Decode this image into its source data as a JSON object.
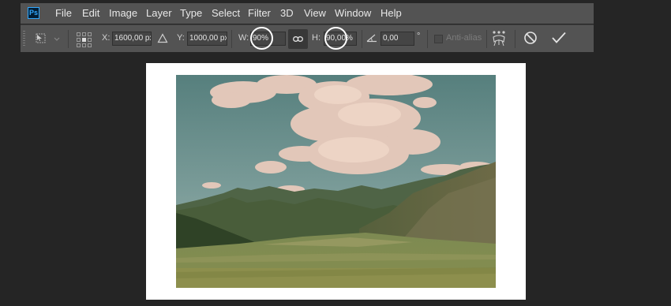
{
  "app": {
    "logo_text": "Ps"
  },
  "menu": {
    "items": [
      "File",
      "Edit",
      "Image",
      "Layer",
      "Type",
      "Select",
      "Filter",
      "3D",
      "View",
      "Window",
      "Help"
    ]
  },
  "options": {
    "x_label": "X:",
    "x_value": "1600,00 px",
    "y_label": "Y:",
    "y_value": "1000,00 px",
    "w_label": "W:",
    "w_value": "90%",
    "h_label": "H:",
    "h_value": "90,00%",
    "angle_value": "0,00",
    "degree_symbol": "°",
    "antialias_label": "Anti-alias"
  },
  "colors": {
    "chrome": "#535353",
    "workspace": "#252525",
    "highlight_circle": "#ffffff"
  }
}
